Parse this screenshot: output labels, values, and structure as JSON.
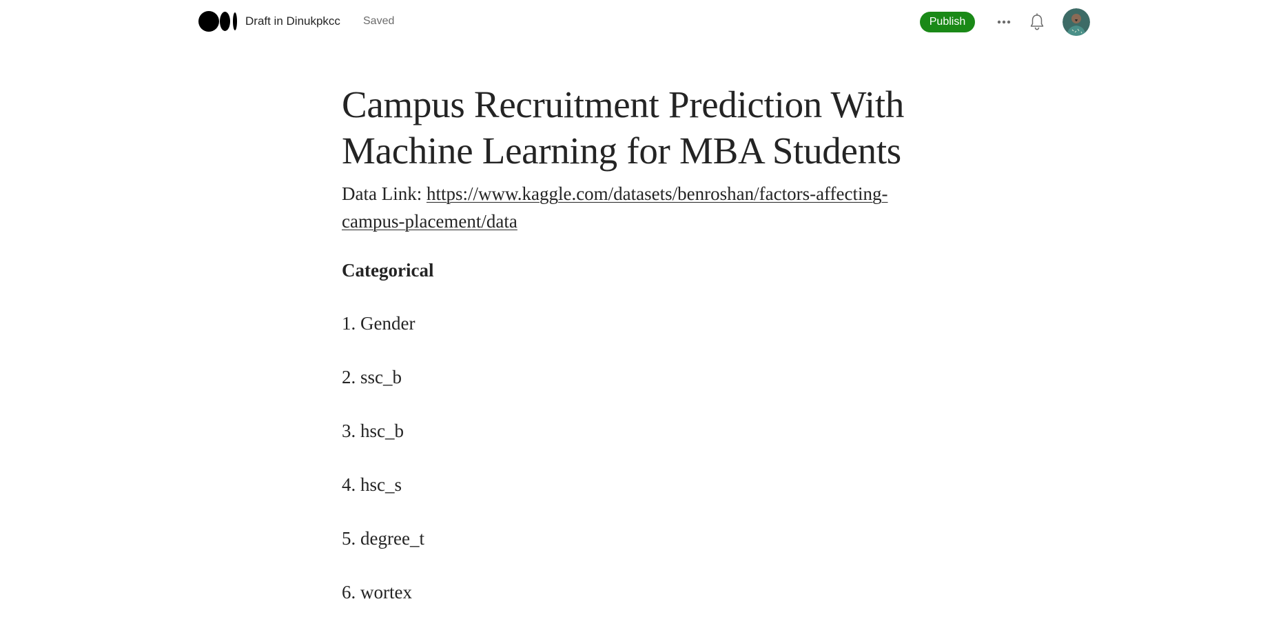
{
  "header": {
    "logo_icon": "medium-logo-icon",
    "draft_label": "Draft in Dinukpkcc",
    "status": "Saved",
    "publish_label": "Publish",
    "more_icon": "more-horizontal-icon",
    "notifications_icon": "bell-icon",
    "avatar_icon": "user-avatar",
    "accent_color": "#1a8917"
  },
  "article": {
    "title": "Campus Recruitment Prediction With Machine Learning for MBA Students",
    "data_link_prefix": "Data Link: ",
    "data_link_url": "https://www.kaggle.com/datasets/benroshan/factors-affecting-campus-placement/data",
    "section_heading": "Categorical",
    "list_items": [
      "1. Gender",
      "2. ssc_b",
      "3. hsc_b",
      "4. hsc_s",
      "5. degree_t",
      "6. wortex"
    ]
  }
}
